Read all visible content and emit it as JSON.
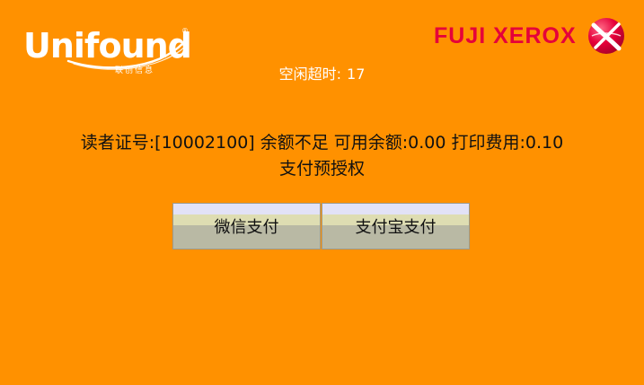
{
  "brand_left": {
    "name": "Unifound",
    "registered_mark": "®",
    "subtitle": "联创信息"
  },
  "brand_right": {
    "name": "FUJI XEROX"
  },
  "idle": {
    "label": "空闲超时:",
    "seconds": "17"
  },
  "message": {
    "line1": "读者证号:[10002100] 余额不足 可用余额:0.00 打印费用:0.10",
    "line2": "支付预授权"
  },
  "buttons": {
    "wechat_label": "微信支付",
    "alipay_label": "支付宝支付"
  },
  "colors": {
    "background": "#FF9100",
    "fuji_red": "#E5003A",
    "text_dark": "#111111",
    "text_light": "#FFFFFF"
  },
  "icons": {
    "left_logo": "unifound-logo",
    "right_logo": "fuji-xerox-sphere-icon"
  }
}
